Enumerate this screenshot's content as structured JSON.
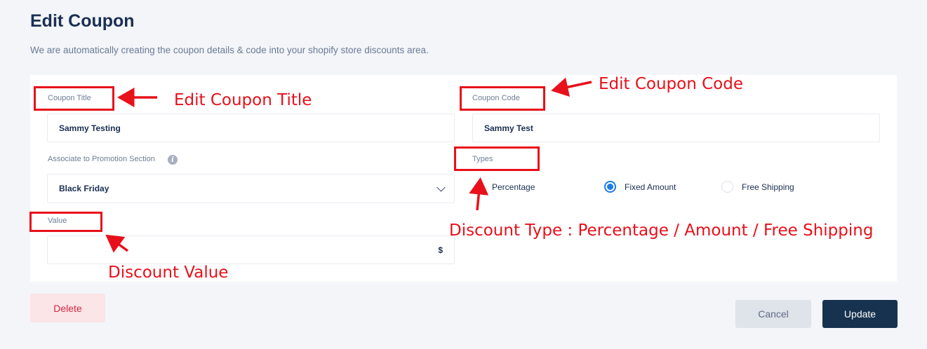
{
  "header": {
    "title": "Edit Coupon",
    "subtitle": "We are automatically creating the coupon details & code into your shopify store discounts area."
  },
  "form": {
    "coupon_title": {
      "label": "Coupon Title",
      "value": "Sammy Testing"
    },
    "coupon_code": {
      "label": "Coupon Code",
      "value": "Sammy Test"
    },
    "promotion_section": {
      "label": "Associate to Promotion Section",
      "value": "Black Friday",
      "info_icon": "info-icon"
    },
    "types": {
      "label": "Types",
      "options": [
        {
          "label": "Percentage",
          "selected": false
        },
        {
          "label": "Fixed Amount",
          "selected": true
        },
        {
          "label": "Free Shipping",
          "selected": false
        }
      ]
    },
    "value": {
      "label": "Value",
      "value": "",
      "unit": "$"
    }
  },
  "buttons": {
    "delete": "Delete",
    "cancel": "Cancel",
    "update": "Update"
  },
  "annotations": {
    "coupon_title": "Edit Coupon Title",
    "coupon_code": "Edit Coupon Code",
    "discount_type": "Discount Type : Percentage / Amount / Free Shipping",
    "discount_value": "Discount Value",
    "color": "#e8101a"
  }
}
